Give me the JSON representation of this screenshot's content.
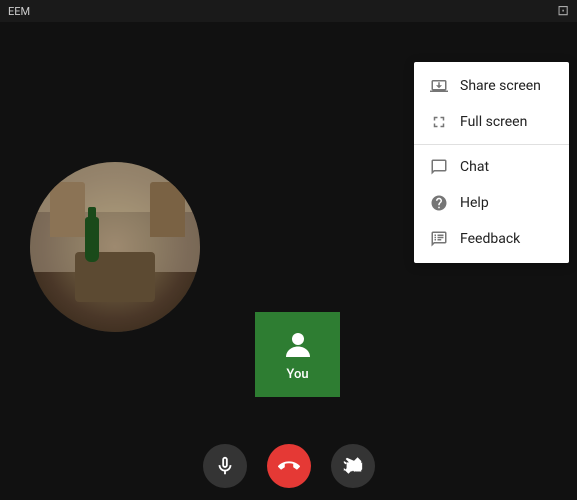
{
  "titleBar": {
    "appName": "EEM",
    "windowIconLabel": "window-icon"
  },
  "contextMenu": {
    "items": [
      {
        "id": "share-screen",
        "label": "Share screen",
        "icon": "share-screen-icon"
      },
      {
        "id": "full-screen",
        "label": "Full screen",
        "icon": "fullscreen-icon"
      },
      {
        "id": "chat",
        "label": "Chat",
        "icon": "chat-icon"
      },
      {
        "id": "help",
        "label": "Help",
        "icon": "help-icon"
      },
      {
        "id": "feedback",
        "label": "Feedback",
        "icon": "feedback-icon"
      }
    ]
  },
  "youTile": {
    "label": "You"
  },
  "controls": {
    "micLabel": "mic-button",
    "endCallLabel": "end-call-button",
    "cameraLabel": "camera-off-button"
  }
}
